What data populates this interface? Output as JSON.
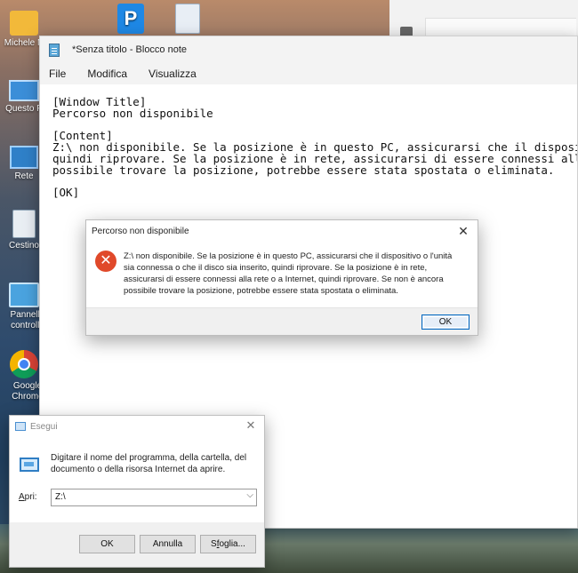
{
  "desktop": {
    "icons": [
      {
        "label": "Michele N",
        "icon": "user-folder-icon"
      },
      {
        "label": "Questo P",
        "icon": "this-pc-icon"
      },
      {
        "label": "Rete",
        "icon": "network-icon"
      },
      {
        "label": "Cestino",
        "icon": "recycle-bin-icon"
      },
      {
        "label": "Pannello controllo",
        "icon": "control-panel-icon"
      },
      {
        "label": "Google Chrome",
        "icon": "chrome-icon"
      }
    ]
  },
  "notepad": {
    "title": "*Senza titolo - Blocco note",
    "menus": [
      "File",
      "Modifica",
      "Visualizza"
    ],
    "content": "[Window Title]\nPercorso non disponibile\n\n[Content]\nZ:\\ non disponibile. Se la posizione è in questo PC, assicurarsi che il dispositivo\nquindi riprovare. Se la posizione è in rete, assicurarsi di essere connessi alla re\npossibile trovare la posizione, potrebbe essere stata spostata o eliminata.\n\n[OK]"
  },
  "error_dialog": {
    "title": "Percorso non disponibile",
    "message": "Z:\\ non disponibile. Se la posizione è in questo PC, assicurarsi che il dispositivo o l'unità sia connessa o che il disco sia inserito, quindi riprovare. Se la posizione è in rete, assicurarsi di essere connessi alla rete o a Internet, quindi riprovare. Se non è ancora possibile trovare la posizione, potrebbe essere stata spostata o eliminata.",
    "ok_label": "OK",
    "close_glyph": "✕",
    "error_glyph": "✕"
  },
  "run_dialog": {
    "title": "Esegui",
    "description": "Digitare il nome del programma, della cartella, del documento o della risorsa Internet da aprire.",
    "open_label_accel": "A",
    "open_label_rest": "pri:",
    "open_value": "Z:\\",
    "ok_label": "OK",
    "cancel_label": "Annulla",
    "browse_accel": "f",
    "browse_pre": "S",
    "browse_post": "oglia...",
    "close_glyph": "✕",
    "dropdown_glyph": "⌵"
  }
}
